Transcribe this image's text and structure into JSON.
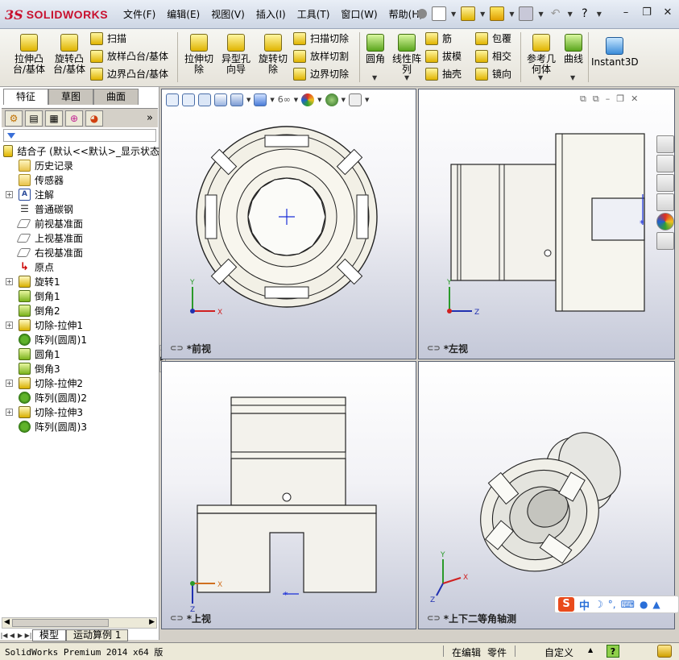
{
  "app": {
    "logo_ds": "3S",
    "logo_text": "SOLIDWORKS"
  },
  "menus": [
    "文件(F)",
    "编辑(E)",
    "视图(V)",
    "插入(I)",
    "工具(T)",
    "窗口(W)",
    "帮助(H)"
  ],
  "ribbon": {
    "extrude_boss": "拉伸凸\n台/基体",
    "revolve_boss": "旋转凸\n台/基体",
    "sweep": "扫描",
    "loft": "放样凸台/基体",
    "boundary_boss": "边界凸台/基体",
    "extrude_cut": "拉伸切\n除",
    "hole_wizard": "异型孔\n向导",
    "revolve_cut": "旋转切\n除",
    "swept_cut": "扫描切除",
    "lofted_cut": "放样切割",
    "boundary_cut": "边界切除",
    "fillet": "圆角",
    "linear_pattern": "线性阵\n列",
    "rib": "筋",
    "draft": "拔模",
    "shell": "抽壳",
    "wrap": "包覆",
    "intersect": "相交",
    "mirror": "镜向",
    "ref_geometry": "参考几\n何体",
    "curves": "曲线",
    "instant3d": "Instant3D"
  },
  "left_panel": {
    "tabs": [
      "特征",
      "草图",
      "曲面"
    ],
    "active_tab": "特征",
    "more": "»",
    "root": "结合子  (默认<<默认>_显示状态",
    "tree": [
      {
        "label": "历史记录",
        "icon": "folder-icon",
        "kind": "folder",
        "expand": false
      },
      {
        "label": "传感器",
        "icon": "sensor-icon",
        "kind": "folder",
        "expand": false
      },
      {
        "label": "注解",
        "icon": "annotation-icon",
        "kind": "note",
        "expand": true
      },
      {
        "label": "普通碳钢",
        "icon": "material-icon",
        "kind": "mat",
        "expand": false
      },
      {
        "label": "前视基准面",
        "icon": "plane-icon",
        "kind": "plane",
        "expand": false
      },
      {
        "label": "上视基准面",
        "icon": "plane-icon",
        "kind": "plane",
        "expand": false
      },
      {
        "label": "右视基准面",
        "icon": "plane-icon",
        "kind": "plane",
        "expand": false
      },
      {
        "label": "原点",
        "icon": "origin-icon",
        "kind": "origin",
        "expand": false
      },
      {
        "label": "旋转1",
        "icon": "revolve-icon",
        "kind": "feat",
        "expand": true
      },
      {
        "label": "倒角1",
        "icon": "chamfer-icon",
        "kind": "green",
        "expand": false
      },
      {
        "label": "倒角2",
        "icon": "chamfer-icon",
        "kind": "green",
        "expand": false
      },
      {
        "label": "切除-拉伸1",
        "icon": "cut-extrude-icon",
        "kind": "feat",
        "expand": true
      },
      {
        "label": "阵列(圆周)1",
        "icon": "circular-pattern-icon",
        "kind": "pattern",
        "expand": false
      },
      {
        "label": "圆角1",
        "icon": "fillet-icon",
        "kind": "green",
        "expand": false
      },
      {
        "label": "倒角3",
        "icon": "chamfer-icon",
        "kind": "green",
        "expand": false
      },
      {
        "label": "切除-拉伸2",
        "icon": "cut-extrude-icon",
        "kind": "feat",
        "expand": true
      },
      {
        "label": "阵列(圆周)2",
        "icon": "circular-pattern-icon",
        "kind": "pattern",
        "expand": false
      },
      {
        "label": "切除-拉伸3",
        "icon": "cut-extrude-icon",
        "kind": "feat",
        "expand": true
      },
      {
        "label": "阵列(圆周)3",
        "icon": "circular-pattern-icon",
        "kind": "pattern",
        "expand": false
      }
    ]
  },
  "bottom_tabs": [
    "模型",
    "运动算例 1"
  ],
  "viewports": {
    "front": "*前视",
    "left": "*左视",
    "top": "*上视",
    "iso": "*上下二等角轴测"
  },
  "axes": {
    "x": "X",
    "y": "Y",
    "z": "Z"
  },
  "ime": {
    "logo": "S",
    "lang": "中",
    "moon": "☽",
    "punct": "°,",
    "keyboard": "⌨"
  },
  "status": {
    "product": "SolidWorks Premium 2014 x64 版",
    "mode": "在编辑",
    "doc_type": "零件",
    "units": "自定义",
    "help": "?"
  },
  "colors": {
    "accent_red": "#c8102e",
    "feature_yellow": "#e0b400",
    "pattern_green": "#5aa61c",
    "ime_orange": "#e94b1c"
  }
}
